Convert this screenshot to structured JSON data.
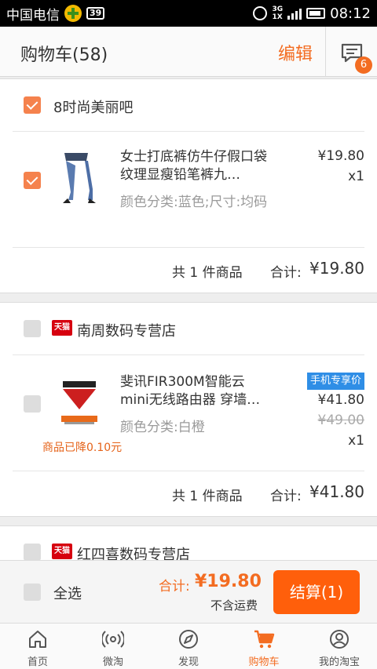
{
  "status_bar": {
    "carrier": "中国电信",
    "badge": "39",
    "network": "3G",
    "network2": "1X",
    "time": "08:12"
  },
  "header": {
    "title": "购物车(58)",
    "edit_label": "编辑",
    "message_badge": "6"
  },
  "shops": [
    {
      "name": "8时尚美丽吧",
      "checked": true,
      "tmall": false,
      "item": {
        "title": "女士打底裤仿牛仔假口袋纹理显瘦铅笔裤九…",
        "spec": "颜色分类:蓝色;尺寸:均码",
        "price": "¥19.80",
        "qty": "x1",
        "checked": true
      },
      "summary": {
        "count": "共 1 件商品",
        "total_label": "合计:",
        "total": "¥19.80"
      }
    },
    {
      "name": "南周数码专营店",
      "checked": false,
      "tmall": true,
      "tmall_label": "天猫",
      "item": {
        "title": "斐讯FIR300M智能云mini无线路由器 穿墙…",
        "spec": "颜色分类:白橙",
        "mobile_tag": "手机专享价",
        "price": "¥41.80",
        "old_price": "¥49.00",
        "qty": "x1",
        "drop_note": "商品已降0.10元",
        "checked": false
      },
      "summary": {
        "count": "共 1 件商品",
        "total_label": "合计:",
        "total": "¥41.80"
      }
    },
    {
      "name": "红四喜数码专营店",
      "checked": false,
      "tmall": true,
      "tmall_label": "天猫"
    }
  ],
  "checkout": {
    "select_all": "全选",
    "total_label": "合计:",
    "total_value": "¥19.80",
    "freight_note": "不含运费",
    "button": "结算(1)"
  },
  "tabs": [
    {
      "label": "首页",
      "icon": "home-icon"
    },
    {
      "label": "微淘",
      "icon": "broadcast-icon"
    },
    {
      "label": "发现",
      "icon": "compass-icon"
    },
    {
      "label": "购物车",
      "icon": "cart-icon",
      "active": true
    },
    {
      "label": "我的淘宝",
      "icon": "profile-icon"
    }
  ],
  "colors": {
    "accent": "#f36c21",
    "checkout_button": "#ff5f0b",
    "checkbox_on": "#f5824d",
    "mobile_tag": "#2f8ee6",
    "tmall_red": "#d6000f"
  }
}
